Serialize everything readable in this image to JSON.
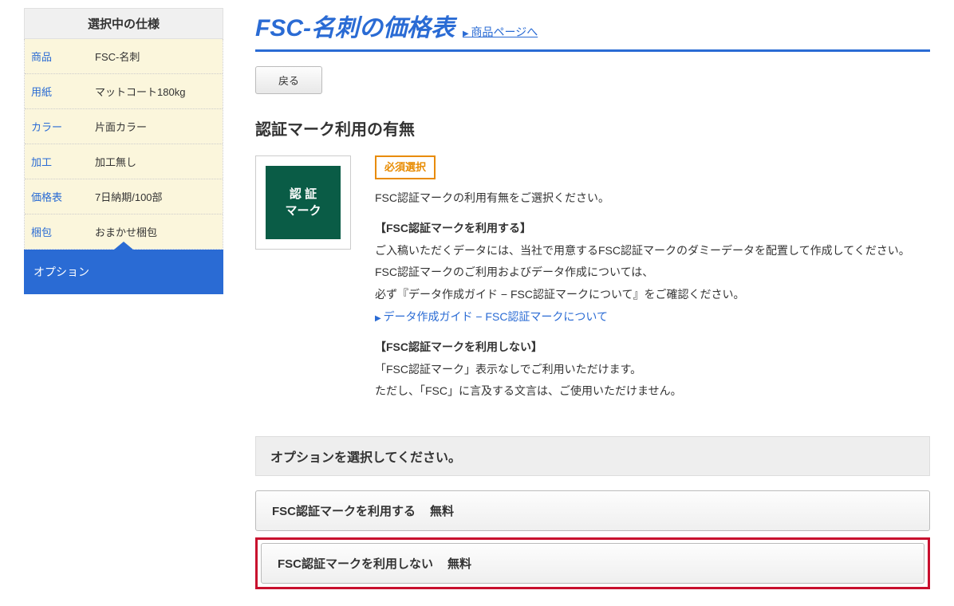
{
  "sidebar": {
    "header": "選択中の仕様",
    "specs": [
      {
        "label": "商品",
        "value": "FSC-名刺"
      },
      {
        "label": "用紙",
        "value": "マットコート180kg"
      },
      {
        "label": "カラー",
        "value": "片面カラー"
      },
      {
        "label": "加工",
        "value": "加工無し"
      },
      {
        "label": "価格表",
        "value": "7日納期/100部"
      },
      {
        "label": "梱包",
        "value": "おまかせ梱包"
      }
    ],
    "active": "オプション"
  },
  "header": {
    "title": "FSC-名刺の価格表",
    "link": "商品ページへ",
    "back": "戻る"
  },
  "section": {
    "title": "認証マーク利用の有無",
    "thumb_line1": "認 証",
    "thumb_line2": "マーク",
    "badge": "必須選択",
    "intro": "FSC認証マークの利用有無をご選択ください。",
    "use_title": "【FSC認証マークを利用する】",
    "use_body1": "ご入稿いただくデータには、当社で用意するFSC認証マークのダミーデータを配置して作成してください。",
    "use_body2": "FSC認証マークのご利用およびデータ作成については、",
    "use_body3": "必ず『データ作成ガイド − FSC認証マークについて』をご確認ください。",
    "use_link": "データ作成ガイド − FSC認証マークについて",
    "nouse_title": "【FSC認証マークを利用しない】",
    "nouse_body1": "「FSC認証マーク」表示なしでご利用いただけます。",
    "nouse_body2": "ただし、「FSC」に言及する文言は、ご使用いただけません。"
  },
  "options": {
    "header": "オプションを選択してください。",
    "items": [
      {
        "label": "FSC認証マークを利用する",
        "price": "無料"
      },
      {
        "label": "FSC認証マークを利用しない",
        "price": "無料"
      }
    ]
  }
}
